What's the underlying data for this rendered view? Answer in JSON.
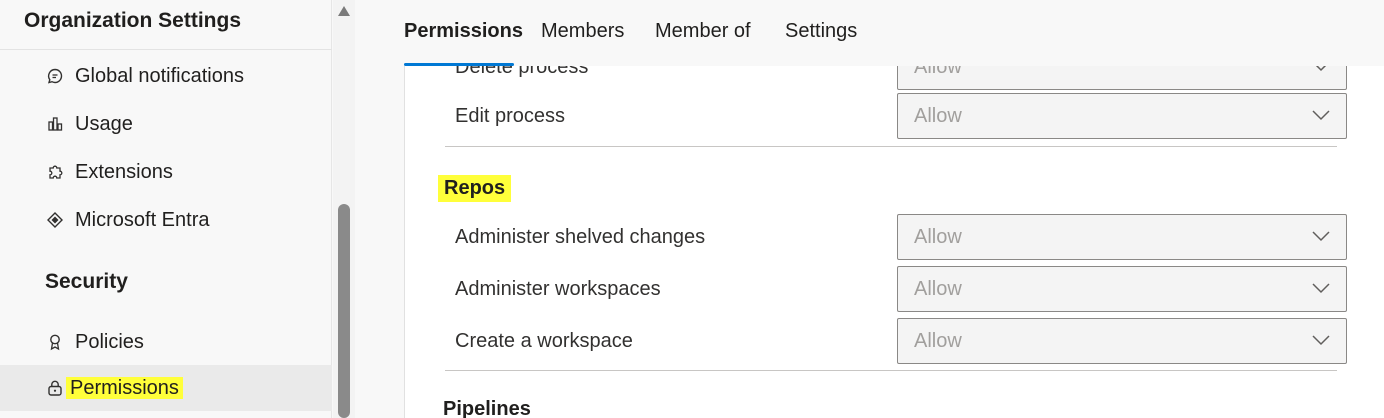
{
  "sidebar": {
    "title": "Organization Settings",
    "items": [
      {
        "label": "Global notifications",
        "icon": "notification-bubble-icon"
      },
      {
        "label": "Usage",
        "icon": "usage-chart-icon"
      },
      {
        "label": "Extensions",
        "icon": "extensions-puzzle-icon"
      },
      {
        "label": "Microsoft Entra",
        "icon": "entra-diamond-icon"
      }
    ],
    "security_section": "Security",
    "security_items": [
      {
        "label": "Policies",
        "icon": "policy-ribbon-icon"
      },
      {
        "label": "Permissions",
        "icon": "lock-icon",
        "selected": true
      }
    ]
  },
  "tabs": [
    {
      "label": "Permissions",
      "active": true
    },
    {
      "label": "Members"
    },
    {
      "label": "Member of"
    },
    {
      "label": "Settings"
    }
  ],
  "permissions": {
    "top_rows": [
      {
        "label": "Delete process",
        "value": "Allow"
      },
      {
        "label": "Edit process",
        "value": "Allow"
      }
    ],
    "groups": [
      {
        "name": "Repos",
        "rows": [
          {
            "label": "Administer shelved changes",
            "value": "Allow"
          },
          {
            "label": "Administer workspaces",
            "value": "Allow"
          },
          {
            "label": "Create a workspace",
            "value": "Allow"
          }
        ]
      },
      {
        "name": "Pipelines",
        "rows": []
      }
    ]
  },
  "colors": {
    "accent": "#0078d4",
    "highlight": "#ffff3a",
    "disabled_text": "#a19f9d"
  }
}
